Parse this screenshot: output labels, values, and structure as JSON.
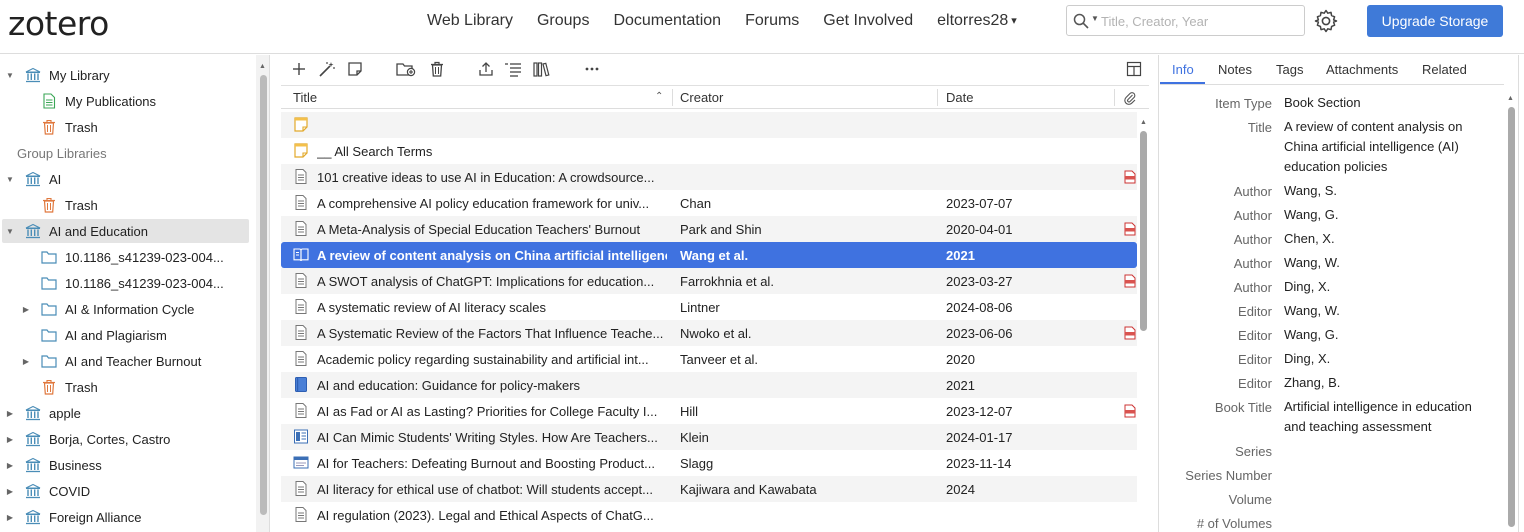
{
  "header": {
    "logo": "zotero",
    "nav": [
      "Web Library",
      "Groups",
      "Documentation",
      "Forums",
      "Get Involved"
    ],
    "user": "eltorres28",
    "search_placeholder": "Title, Creator, Year",
    "upgrade_label": "Upgrade Storage",
    "accent_color": "#3f7ad8"
  },
  "sidebar": {
    "items": [
      {
        "label": "My Library",
        "indent": 0,
        "twisty": "open",
        "icon": "library-icon"
      },
      {
        "label": "My Publications",
        "indent": 1,
        "twisty": "",
        "icon": "publications-icon"
      },
      {
        "label": "Trash",
        "indent": 1,
        "twisty": "",
        "icon": "trash-icon"
      },
      {
        "label": "Group Libraries",
        "indent": 0,
        "twisty": "",
        "icon": "",
        "header": true
      },
      {
        "label": "AI",
        "indent": 0,
        "twisty": "open",
        "icon": "library-icon"
      },
      {
        "label": "Trash",
        "indent": 1,
        "twisty": "",
        "icon": "trash-icon"
      },
      {
        "label": "AI and Education",
        "indent": 0,
        "twisty": "open",
        "icon": "library-icon",
        "selected": true
      },
      {
        "label": "10.1186_s41239-023-004...",
        "indent": 1,
        "twisty": "",
        "icon": "folder-icon"
      },
      {
        "label": "10.1186_s41239-023-004...",
        "indent": 1,
        "twisty": "",
        "icon": "folder-icon"
      },
      {
        "label": "AI & Information Cycle",
        "indent": 1,
        "twisty": "closed",
        "icon": "folder-icon"
      },
      {
        "label": "AI and Plagiarism",
        "indent": 1,
        "twisty": "",
        "icon": "folder-icon"
      },
      {
        "label": "AI and Teacher Burnout",
        "indent": 1,
        "twisty": "closed",
        "icon": "folder-icon"
      },
      {
        "label": "Trash",
        "indent": 1,
        "twisty": "",
        "icon": "trash-icon"
      },
      {
        "label": "apple",
        "indent": 0,
        "twisty": "closed",
        "icon": "library-icon"
      },
      {
        "label": "Borja, Cortes, Castro",
        "indent": 0,
        "twisty": "closed",
        "icon": "library-icon"
      },
      {
        "label": "Business",
        "indent": 0,
        "twisty": "closed",
        "icon": "library-icon"
      },
      {
        "label": "COVID",
        "indent": 0,
        "twisty": "closed",
        "icon": "library-icon"
      },
      {
        "label": "Foreign Alliance",
        "indent": 0,
        "twisty": "closed",
        "icon": "library-icon"
      }
    ]
  },
  "columns": {
    "title": "Title",
    "creator": "Creator",
    "date": "Date"
  },
  "items": [
    {
      "title": "",
      "creator": "",
      "date": "",
      "icon": "note-icon",
      "pdf": false
    },
    {
      "title": "__ All Search Terms",
      "creator": "",
      "date": "",
      "icon": "note-icon",
      "pdf": false
    },
    {
      "title": "101 creative ideas to use AI in Education: A crowdsource...",
      "creator": "",
      "date": "",
      "icon": "document-icon",
      "pdf": true
    },
    {
      "title": "A comprehensive AI policy education framework for univ...",
      "creator": "Chan",
      "date": "2023-07-07",
      "icon": "document-icon",
      "pdf": false
    },
    {
      "title": "A Meta-Analysis of Special Education Teachers' Burnout",
      "creator": "Park and Shin",
      "date": "2020-04-01",
      "icon": "document-icon",
      "pdf": true
    },
    {
      "title": "A review of content analysis on China artificial intelligenc...",
      "creator": "Wang et al.",
      "date": "2021",
      "icon": "book-section-icon",
      "pdf": false,
      "selected": true
    },
    {
      "title": "A SWOT analysis of ChatGPT: Implications for education...",
      "creator": "Farrokhnia et al.",
      "date": "2023-03-27",
      "icon": "document-icon",
      "pdf": true
    },
    {
      "title": "A systematic review of AI literacy scales",
      "creator": "Lintner",
      "date": "2024-08-06",
      "icon": "document-icon",
      "pdf": false
    },
    {
      "title": "A Systematic Review of the Factors That Influence Teache...",
      "creator": "Nwoko et al.",
      "date": "2023-06-06",
      "icon": "document-icon",
      "pdf": true
    },
    {
      "title": "Academic policy regarding sustainability and artificial int...",
      "creator": "Tanveer et al.",
      "date": "2020",
      "icon": "document-icon",
      "pdf": false
    },
    {
      "title": "AI and education: Guidance for policy-makers",
      "creator": "",
      "date": "2021",
      "icon": "book-icon",
      "pdf": false
    },
    {
      "title": "AI as Fad or AI as Lasting? Priorities for College Faculty I...",
      "creator": "Hill",
      "date": "2023-12-07",
      "icon": "document-icon",
      "pdf": true
    },
    {
      "title": "AI Can Mimic Students' Writing Styles. How Are Teachers...",
      "creator": "Klein",
      "date": "2024-01-17",
      "icon": "newspaper-icon",
      "pdf": false
    },
    {
      "title": "AI for Teachers: Defeating Burnout and Boosting Product...",
      "creator": "Slagg",
      "date": "2023-11-14",
      "icon": "webpage-icon",
      "pdf": false
    },
    {
      "title": "AI literacy for ethical use of chatbot: Will students accept...",
      "creator": "Kajiwara and Kawabata",
      "date": "2024",
      "icon": "document-icon",
      "pdf": false
    },
    {
      "title": "AI regulation (2023). Legal and Ethical Aspects of ChatG...",
      "creator": "",
      "date": "",
      "icon": "document-icon",
      "pdf": false
    }
  ],
  "tabs": [
    "Info",
    "Notes",
    "Tags",
    "Attachments",
    "Related"
  ],
  "info": [
    {
      "label": "Item Type",
      "value": "Book Section",
      "lines": 1
    },
    {
      "label": "Title",
      "value": "A review of content analysis on China artificial intelligence (AI) education policies",
      "lines": 3
    },
    {
      "label": "Author",
      "value": "Wang, S.",
      "lines": 1
    },
    {
      "label": "Author",
      "value": "Wang, G.",
      "lines": 1
    },
    {
      "label": "Author",
      "value": "Chen, X.",
      "lines": 1
    },
    {
      "label": "Author",
      "value": "Wang, W.",
      "lines": 1
    },
    {
      "label": "Author",
      "value": "Ding, X.",
      "lines": 1
    },
    {
      "label": "Editor",
      "value": "Wang, W.",
      "lines": 1
    },
    {
      "label": "Editor",
      "value": "Wang, G.",
      "lines": 1
    },
    {
      "label": "Editor",
      "value": "Ding, X.",
      "lines": 1
    },
    {
      "label": "Editor",
      "value": "Zhang, B.",
      "lines": 1
    },
    {
      "label": "Book Title",
      "value": "Artificial intelligence in education and teaching assessment",
      "lines": 2
    },
    {
      "label": "Series",
      "value": "",
      "lines": 1
    },
    {
      "label": "Series Number",
      "value": "",
      "lines": 1
    },
    {
      "label": "Volume",
      "value": "",
      "lines": 1
    },
    {
      "label": "# of Volumes",
      "value": "",
      "lines": 1
    }
  ]
}
